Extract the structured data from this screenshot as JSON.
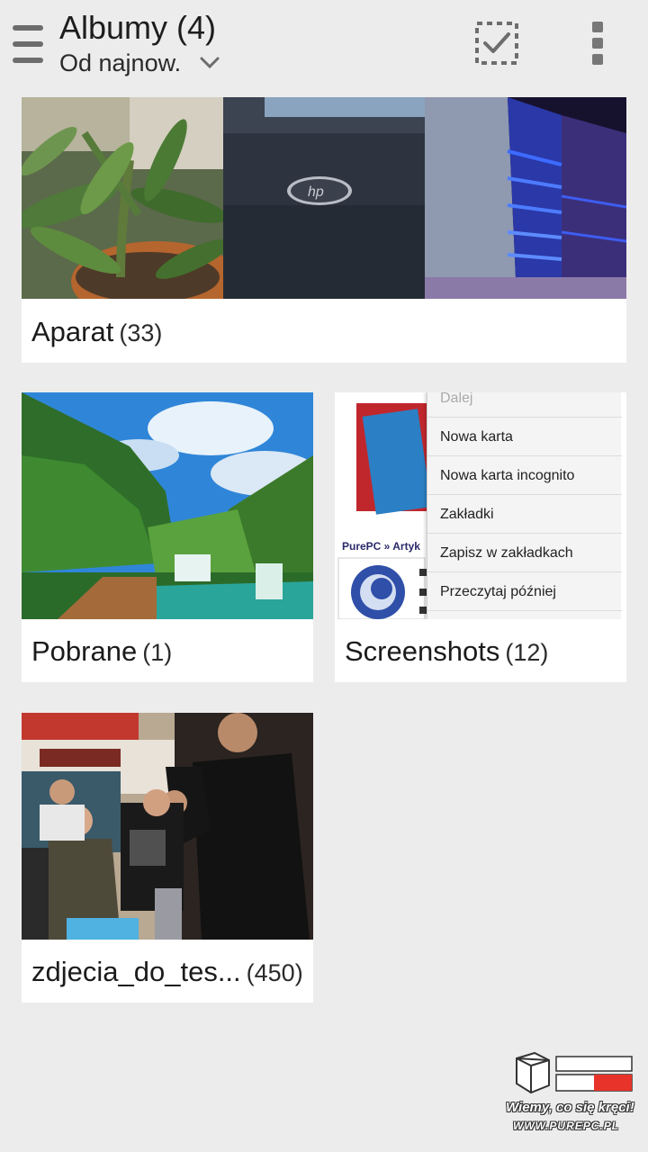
{
  "header": {
    "menu_icon": "hamburger-menu-icon",
    "title": "Albumy (4)",
    "sort_label": "Od najnow.",
    "sort_icon": "chevron-down-icon",
    "select_icon": "select-all-checkbox-icon",
    "overflow_icon": "more-vertical-icon"
  },
  "albums": [
    {
      "name": "Aparat",
      "count": "(33)"
    },
    {
      "name": "Pobrane",
      "count": "(1)"
    },
    {
      "name": "Screenshots",
      "count": "(12)"
    },
    {
      "name": "zdjecia_do_tes...",
      "count": "(450)"
    }
  ],
  "screenshot_preview": {
    "site_text": "PurePC » Artyk",
    "menu_items": [
      "Dalej",
      "Nowa karta",
      "Nowa karta incognito",
      "Zakładki",
      "Zapisz w zakładkach",
      "Przeczytaj później"
    ]
  },
  "watermark": {
    "tagline": "Wiemy, co się kręci!",
    "url": "WWW.PUREPC.PL"
  },
  "colors": {
    "background": "#ececec",
    "card": "#ffffff",
    "icon_gray": "#6d6d6d"
  }
}
